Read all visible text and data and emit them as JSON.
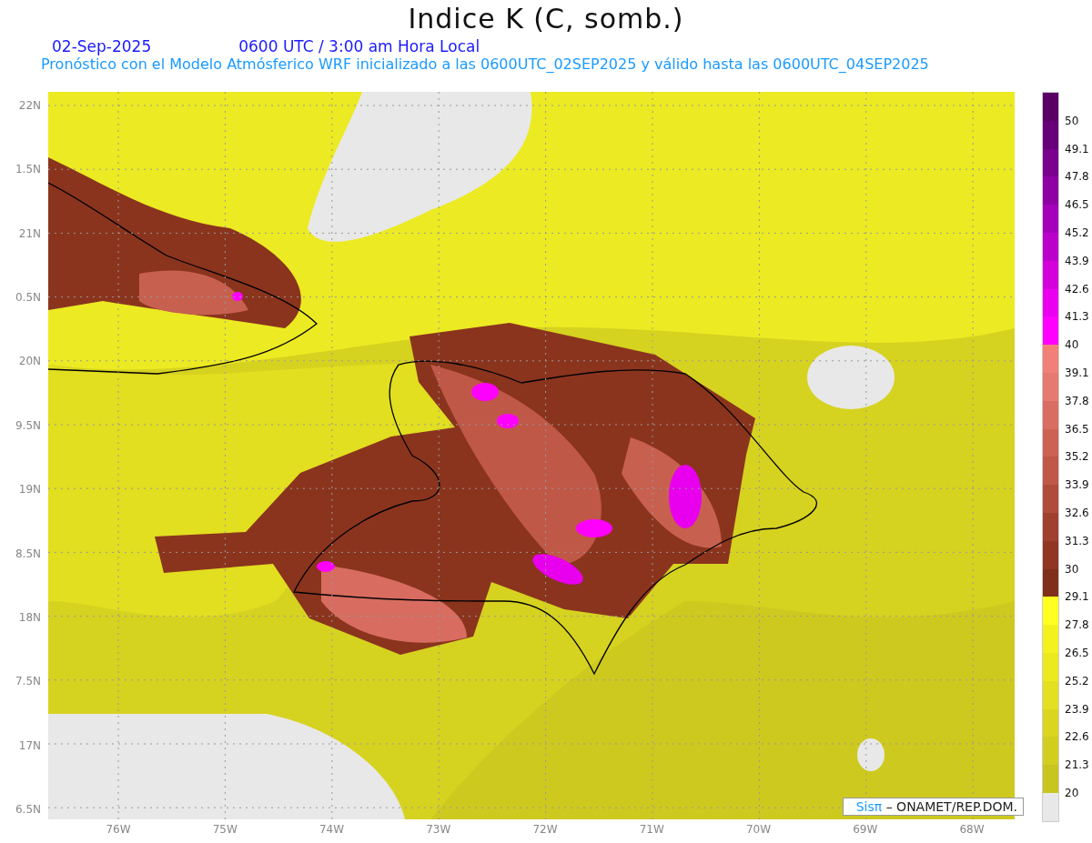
{
  "title": "Indice K (C, somb.)",
  "date": "02-Sep-2025",
  "time": "0600 UTC / 3:00 am Hora Local",
  "subtitle": "Pronóstico con el Modelo Atmósferico WRF inicializado a las 0600UTC_02SEP2025 y válido hasta las  0600UTC_04SEP2025",
  "y_axis": [
    "22N",
    "1.5N",
    "21N",
    "0.5N",
    "20N",
    "9.5N",
    "19N",
    "8.5N",
    "18N",
    "7.5N",
    "17N",
    "6.5N"
  ],
  "x_axis": [
    "76W",
    "75W",
    "74W",
    "73W",
    "72W",
    "71W",
    "70W",
    "69W",
    "68W"
  ],
  "colorbar": {
    "bands": [
      {
        "color": "#5a0064",
        "label": "50"
      },
      {
        "color": "#68007a",
        "label": "49.1"
      },
      {
        "color": "#7a008e",
        "label": "47.8"
      },
      {
        "color": "#8e00a4",
        "label": "46.5"
      },
      {
        "color": "#a400ba",
        "label": "45.2"
      },
      {
        "color": "#bc00cc",
        "label": "43.9"
      },
      {
        "color": "#d400dc",
        "label": "42.6"
      },
      {
        "color": "#ea00ee",
        "label": "41.3"
      },
      {
        "color": "#ff00ff",
        "label": "40"
      },
      {
        "color": "#f08078",
        "label": "39.1"
      },
      {
        "color": "#e47a70",
        "label": "37.8"
      },
      {
        "color": "#d86e62",
        "label": "36.5"
      },
      {
        "color": "#cc6252",
        "label": "35.2"
      },
      {
        "color": "#c05848",
        "label": "33.9"
      },
      {
        "color": "#b04c3a",
        "label": "32.6"
      },
      {
        "color": "#a0402e",
        "label": "31.3"
      },
      {
        "color": "#903622",
        "label": "30"
      },
      {
        "color": "#80301a",
        "label": "29.1"
      },
      {
        "color": "#ffff20",
        "label": "27.8"
      },
      {
        "color": "#f4f21e",
        "label": "26.5"
      },
      {
        "color": "#eaea1e",
        "label": "25.2"
      },
      {
        "color": "#e2e020",
        "label": "23.9"
      },
      {
        "color": "#dad620",
        "label": "22.6"
      },
      {
        "color": "#d2ce20",
        "label": "21.3"
      },
      {
        "color": "#c8c420",
        "label": "20"
      },
      {
        "color": "#e8e8e8"
      }
    ]
  },
  "credit": {
    "brand": "Sisπ",
    "text": "– ONAMET/REP.DOM."
  }
}
